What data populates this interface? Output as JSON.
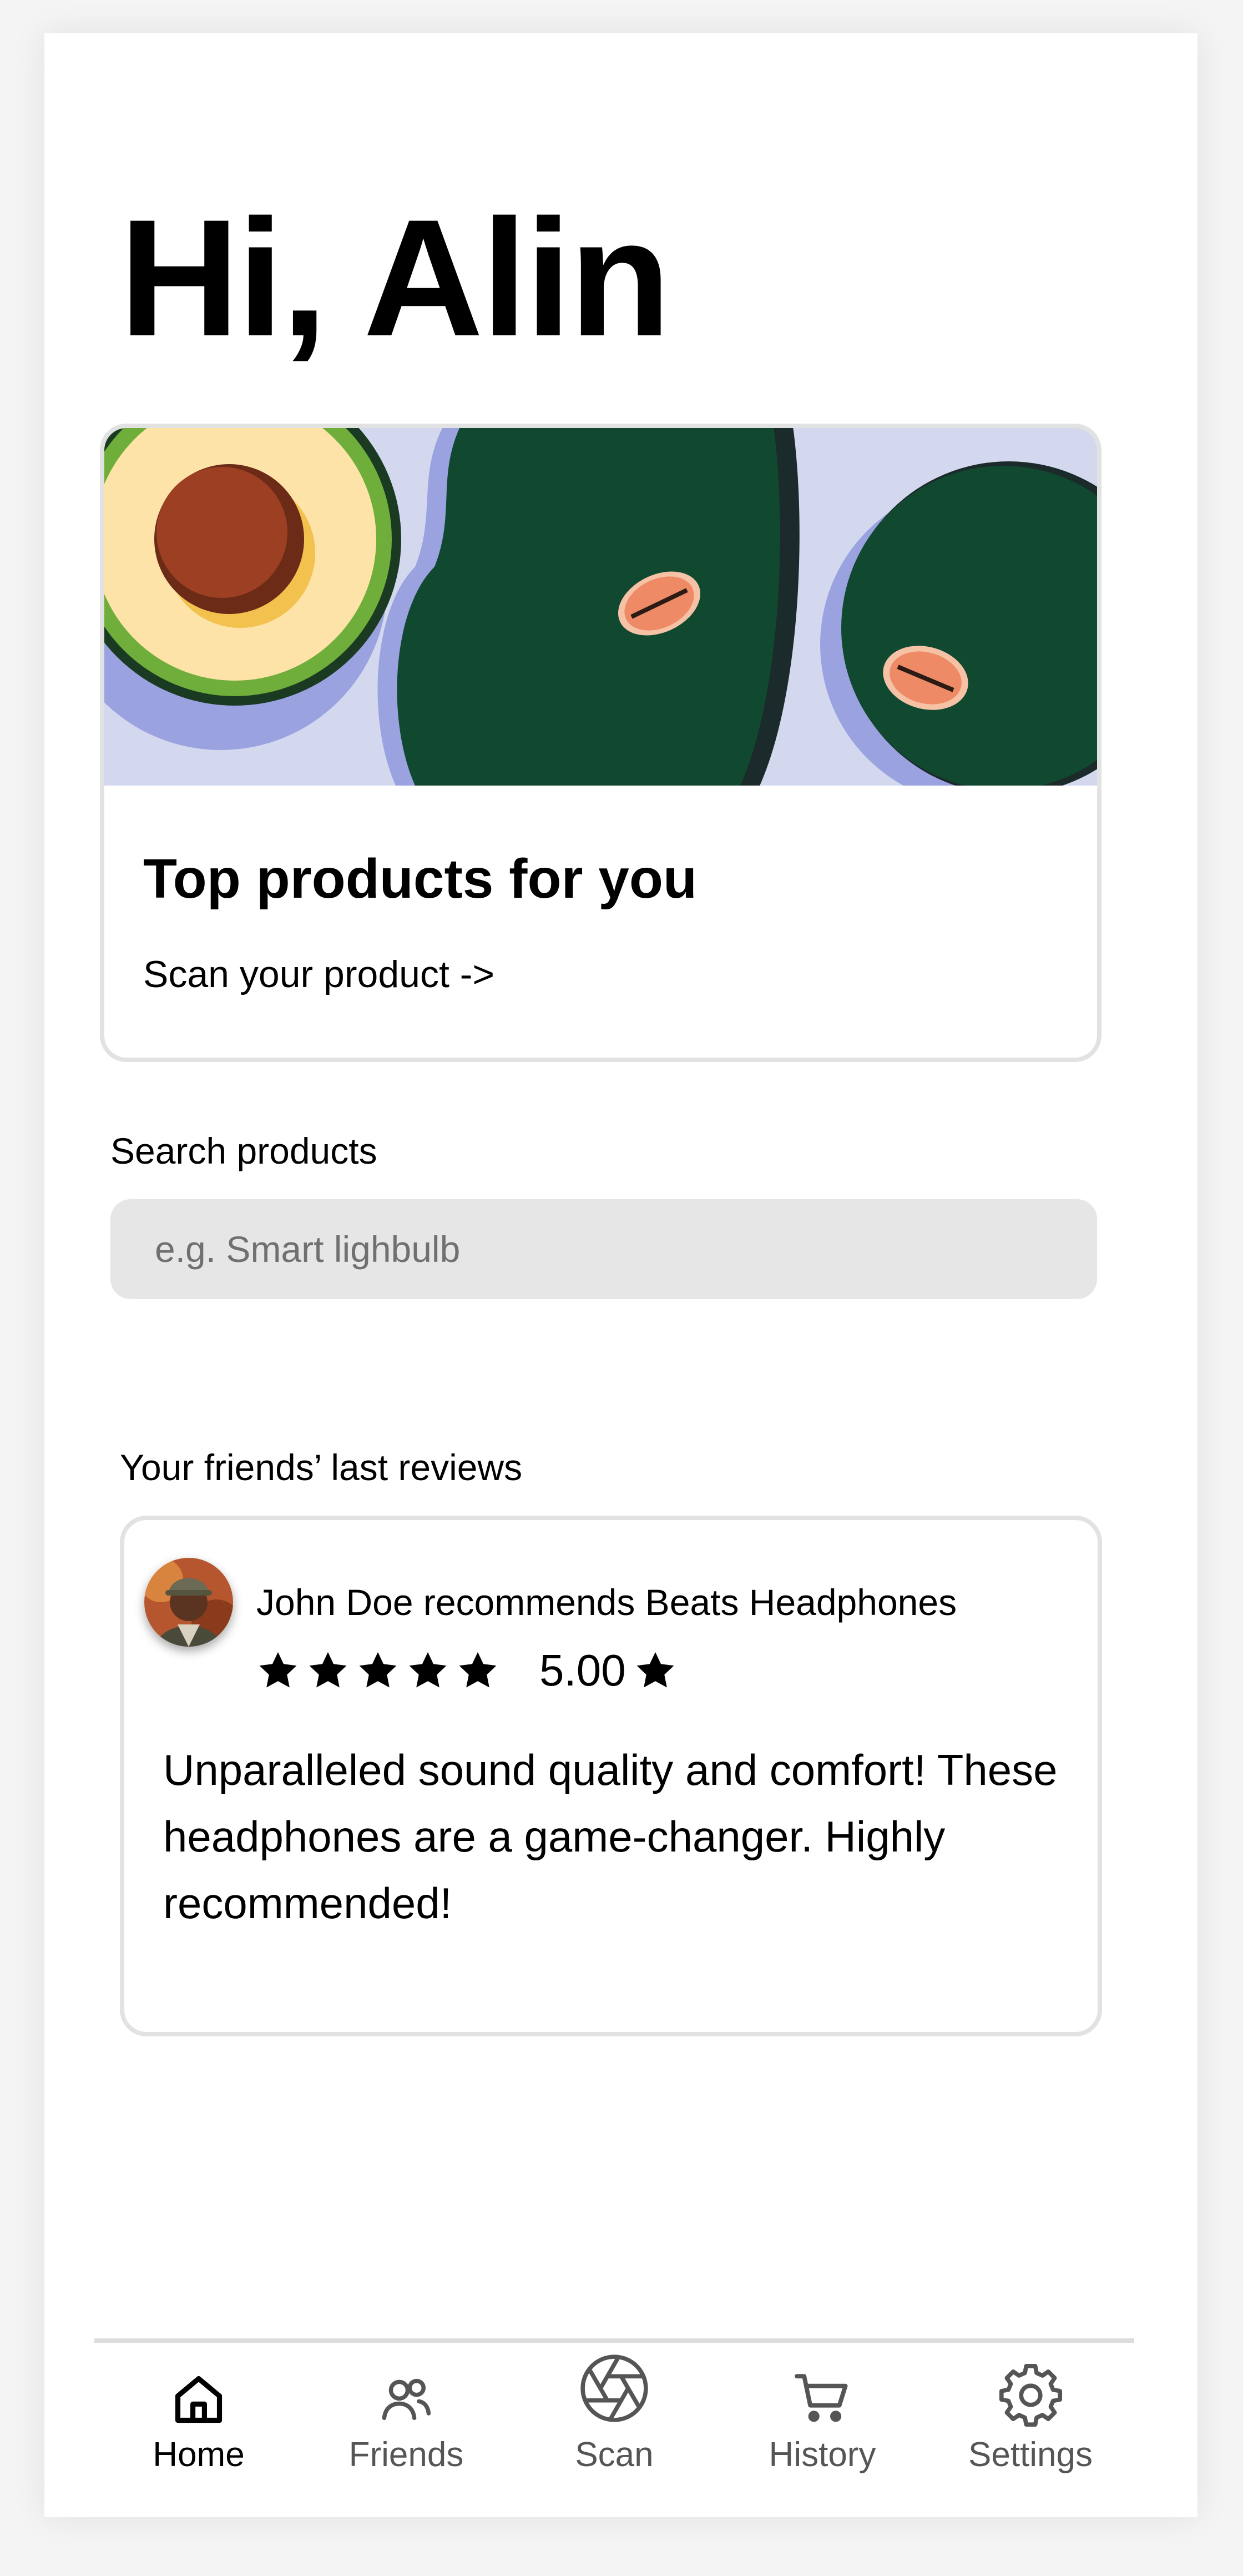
{
  "greeting": "Hi, Alin",
  "promo": {
    "title": "Top products for you",
    "link": "Scan your product ->"
  },
  "search": {
    "label": "Search products",
    "placeholder": "e.g. Smart lighbulb"
  },
  "reviews": {
    "title": "Your friends’ last reviews",
    "items": [
      {
        "headline": "John Doe recommends Beats Headphones",
        "stars": 5,
        "rating": "5.00",
        "text": "Unparalleled sound quality and comfort! These headphones are a game-changer. Highly recommended!"
      }
    ]
  },
  "nav": {
    "items": [
      {
        "label": "Home",
        "icon": "home-icon",
        "active": true
      },
      {
        "label": "Friends",
        "icon": "friends-icon",
        "active": false
      },
      {
        "label": "Scan",
        "icon": "camera-shutter-icon",
        "active": false
      },
      {
        "label": "History",
        "icon": "cart-icon",
        "active": false
      },
      {
        "label": "Settings",
        "icon": "gear-icon",
        "active": false
      }
    ]
  },
  "colors": {
    "banner_bg": "#d3d8ef",
    "avocado_dark": "#114830",
    "avocado_shadow": "#9aa2e0",
    "search_bg": "#e6e6e6",
    "card_border": "#e2e2e2"
  }
}
